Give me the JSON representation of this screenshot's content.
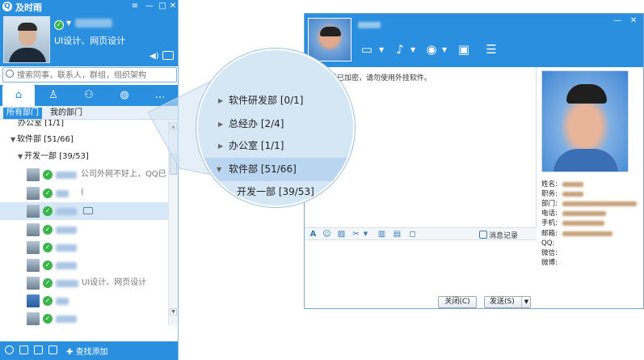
{
  "app": {
    "title": "及时雨"
  },
  "window_controls": {
    "menu": "≡",
    "minimize": "—",
    "maximize": "□",
    "close": "✕"
  },
  "profile": {
    "signature": "UI设计、网页设计"
  },
  "search": {
    "placeholder": "搜索同事，联系人，群组，组织架构"
  },
  "main_tabs": [
    {
      "icon": "home-icon",
      "glyph": "⌂"
    },
    {
      "icon": "person-icon",
      "glyph": "♙"
    },
    {
      "icon": "group-icon",
      "glyph": "⚇"
    },
    {
      "icon": "globe-icon",
      "glyph": "◍"
    },
    {
      "icon": "chat-bubble-icon",
      "glyph": "…"
    }
  ],
  "sub_tabs": {
    "all_departments": "所有部门",
    "my_department": "我的部门"
  },
  "tree": {
    "partial_top": "办公室 [1/1]",
    "software_dept": "软件部 [51/66]",
    "dev_dept1": "开发一部 [39/53]",
    "contact1_signature": "公司外网不好上，QQ已(",
    "contact7_signature": "UI设计、网页设计"
  },
  "bottom": {
    "find_add": "查找添加"
  },
  "magnifier": {
    "row1": "软件研发部 [0/1]",
    "row2": "总经办 [2/4]",
    "row3": "办公室 [1/1]",
    "row4": "软件部 [51/66]",
    "row5": "开发一部 [39/53]"
  },
  "chat": {
    "notice": "会话已加密，请勿使用外挂软件。",
    "history": "消息记录",
    "close_button": "关闭(C)",
    "send_button": "发送(S)"
  },
  "card": {
    "name": "姓名:",
    "title": "职务:",
    "dept": "部门:",
    "phone": "电话:",
    "mobile": "手机:",
    "email": "邮箱:",
    "qq": "QQ:",
    "wechat": "微信:",
    "weibo": "微博:"
  },
  "colors": {
    "accent": "#2a8fde",
    "online": "#3bb54a",
    "selected_row": "#d6e7f7",
    "lens_bg": "#d5e6f5"
  }
}
